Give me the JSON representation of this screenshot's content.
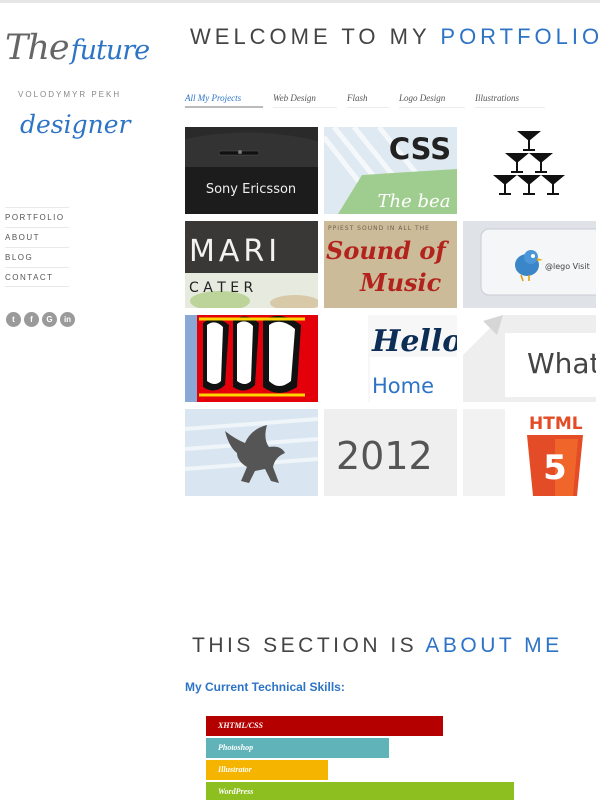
{
  "sidebar": {
    "logo_the": "The",
    "logo_future": "future",
    "owner_name": "VOLODYMYR PEKH",
    "logo_role": "designer",
    "nav": [
      "PORTFOLIO",
      "ABOUT",
      "BLOG",
      "CONTACT"
    ],
    "social": [
      {
        "icon": "twitter-icon",
        "glyph": "t"
      },
      {
        "icon": "facebook-icon",
        "glyph": "f"
      },
      {
        "icon": "google-icon",
        "glyph": "G"
      },
      {
        "icon": "linkedin-icon",
        "glyph": "in"
      }
    ]
  },
  "header": {
    "welcome_prefix": "WELCOME TO MY",
    "welcome_accent": "PORTFOLIO"
  },
  "filters": [
    "All My Projects",
    "Web Design",
    "Flash",
    "Logo Design",
    "Illustrations"
  ],
  "tiles": {
    "sony": "Sony Ericsson",
    "css": "CSS",
    "css_sub": "The bea",
    "marie": "MARI",
    "catering": "C A T E R",
    "sound_top": "PPIEST SOUND IN ALL THE",
    "sound_line1": "Sound of",
    "sound_line2": "Music",
    "twitter_handle": "@lego Visit",
    "hello": "Hello",
    "home": "Home",
    "what": "What",
    "year": "2012",
    "html": "HTML",
    "html_badge": "5"
  },
  "about": {
    "heading_prefix": "THIS SECTION IS",
    "heading_accent": "ABOUT ME",
    "skills_title": "My Current Technical Skills:"
  },
  "skills": [
    {
      "name": "XHTML/CSS",
      "level": 0.7,
      "color": "#b50000"
    },
    {
      "name": "Photoshop",
      "level": 0.54,
      "color": "#5fb3b9"
    },
    {
      "name": "Illustrator",
      "level": 0.36,
      "color": "#f4b400"
    },
    {
      "name": "WordPress",
      "level": 0.91,
      "color": "#8cbf1f"
    }
  ],
  "colors": {
    "accent": "#2d74c6"
  }
}
